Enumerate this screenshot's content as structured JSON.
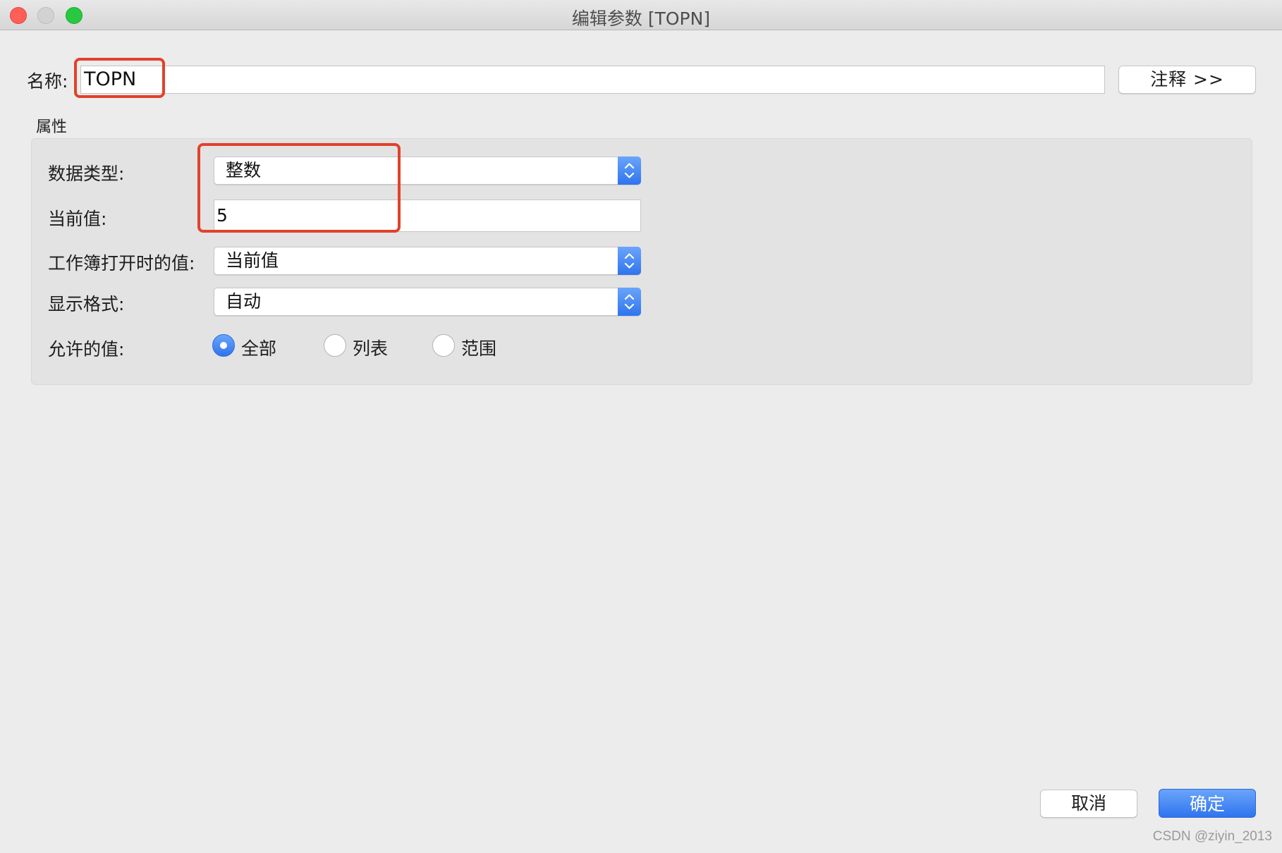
{
  "window": {
    "title": "编辑参数 [TOPN]"
  },
  "name_row": {
    "label": "名称:",
    "value": "TOPN",
    "notes_button": "注释 >>"
  },
  "properties": {
    "section_title": "属性",
    "data_type": {
      "label": "数据类型:",
      "value": "整数"
    },
    "current_value": {
      "label": "当前值:",
      "value": "5"
    },
    "workbook_open_value": {
      "label": "工作簿打开时的值:",
      "value": "当前值"
    },
    "display_format": {
      "label": "显示格式:",
      "value": "自动"
    },
    "allowed_values": {
      "label": "允许的值:",
      "options": [
        {
          "label": "全部",
          "checked": true
        },
        {
          "label": "列表",
          "checked": false
        },
        {
          "label": "范围",
          "checked": false
        }
      ]
    }
  },
  "footer": {
    "cancel": "取消",
    "ok": "确定"
  },
  "watermark": "CSDN @ziyin_2013",
  "colors": {
    "accent": "#2f74ee",
    "annotation": "#e2412b",
    "close": "#fe5f57",
    "maximize": "#28c840"
  }
}
